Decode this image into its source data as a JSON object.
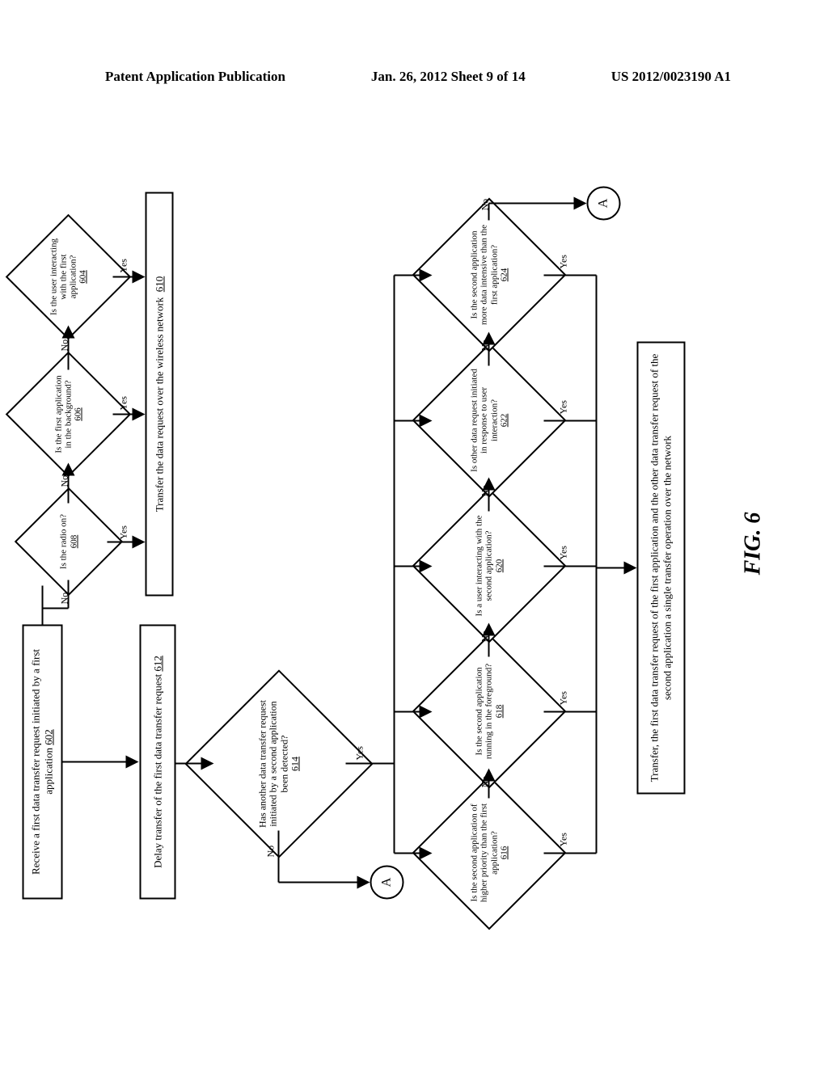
{
  "header": {
    "left": "Patent Application Publication",
    "center": "Jan. 26, 2012  Sheet 9 of 14",
    "right": "US 2012/0023190 A1"
  },
  "figure_label": "FIG. 6",
  "boxes": {
    "b602": "Receive a first data transfer request initiated by a first application",
    "b602_ref": "602",
    "b612": "Delay transfer of the first data transfer request",
    "b612_ref": "612",
    "b610": "Transfer the data request over the wireless network",
    "b610_ref": "610",
    "b626": "Transfer, the first data transfer request of the first application and the other data transfer request of the second application a single transfer operation over the network"
  },
  "diamonds": {
    "d608": "Is the radio on?",
    "d608_ref": "608",
    "d606": "Is the first application in the background?",
    "d606_ref": "606",
    "d604": "Is the user interacting with the first application?",
    "d604_ref": "604",
    "d614": "Has another data transfer request initiated by a second application been detected?",
    "d614_ref": "614",
    "d616": "Is the second application of higher priority than the first application?",
    "d616_ref": "616",
    "d618": "Is the second application running in the foreground?",
    "d618_ref": "618",
    "d620": "Is a user interacting with the second application?",
    "d620_ref": "620",
    "d622": "Is other data request initiated in response to user interaction?",
    "d622_ref": "622",
    "d624": "Is the second application more data intensive than the first application?",
    "d624_ref": "624"
  },
  "connectors": {
    "a": "A"
  },
  "labels": {
    "yes": "Yes",
    "no": "No"
  }
}
